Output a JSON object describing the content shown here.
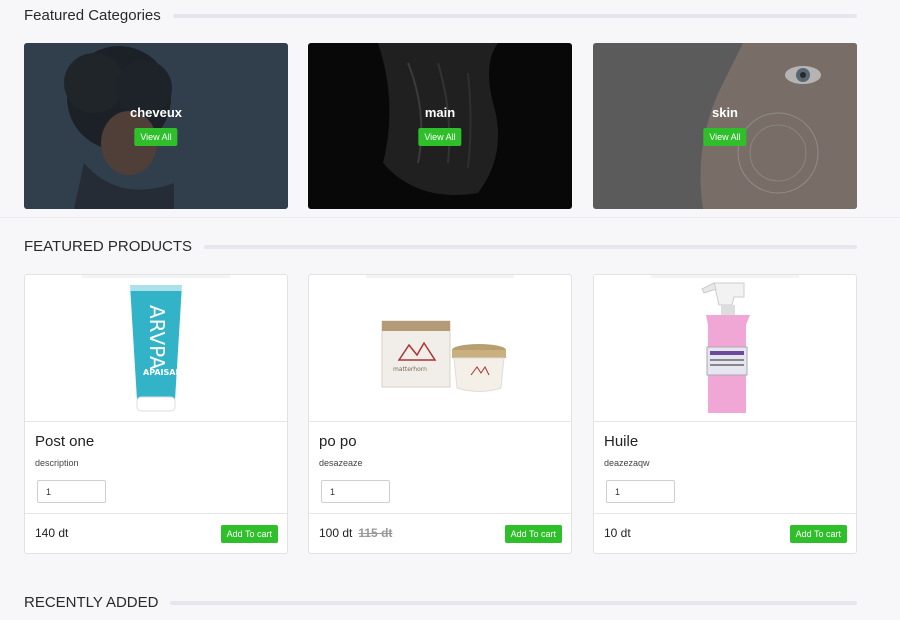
{
  "featured_categories": {
    "title": "Featured Categories",
    "items": [
      {
        "label": "cheveux",
        "button": "View All"
      },
      {
        "label": "main",
        "button": "View All"
      },
      {
        "label": "skin",
        "button": "View All"
      }
    ]
  },
  "featured_products": {
    "title": "FEATURED PRODUCTS",
    "items": [
      {
        "name": "Post one",
        "description": "description",
        "quantity": "1",
        "price": "140 dt",
        "old_price": "",
        "button": "Add To cart",
        "product_label": "APAISANTE",
        "brand": "ARVPA"
      },
      {
        "name": "po po",
        "description": "desazeaze",
        "quantity": "1",
        "price": "100 dt",
        "old_price": "115 dt",
        "button": "Add To cart",
        "product_label": "matterhorn"
      },
      {
        "name": "Huile",
        "description": "deazezaqw",
        "quantity": "1",
        "price": "10 dt",
        "old_price": "",
        "button": "Add To cart"
      }
    ]
  },
  "recently_added": {
    "title": "RECENTLY ADDED"
  },
  "colors": {
    "accent_green": "#2fbf2b",
    "rule_gray": "#e6e6ee"
  }
}
